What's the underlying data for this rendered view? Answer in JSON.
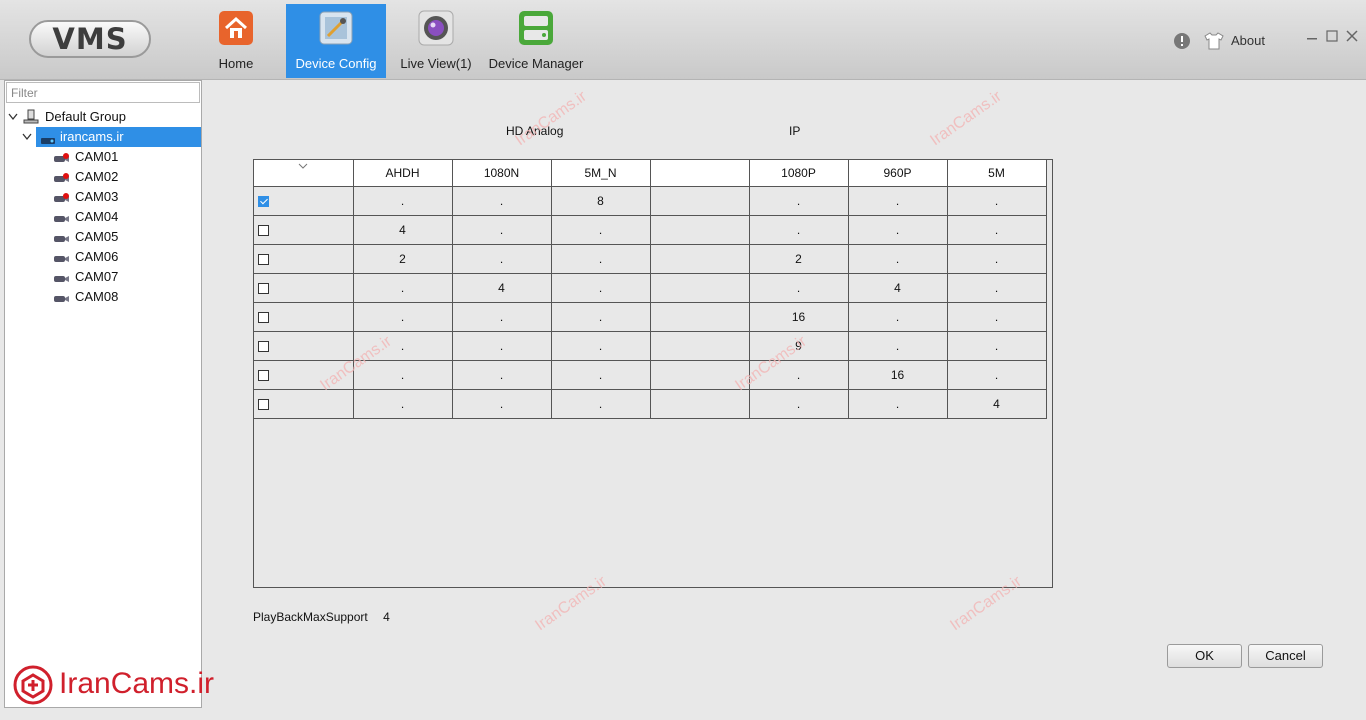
{
  "header": {
    "logo_text": "VMS",
    "tabs": [
      {
        "id": "home",
        "label": "Home",
        "icon": "house-icon"
      },
      {
        "id": "device_config",
        "label": "Device Config",
        "icon": "config-icon",
        "active": true
      },
      {
        "id": "live_view",
        "label": "Live View(1)",
        "icon": "camera-lens-icon"
      },
      {
        "id": "device_manager",
        "label": "Device Manager",
        "icon": "device-manager-icon"
      }
    ],
    "about_label": "About"
  },
  "sidebar": {
    "filter_placeholder": "Filter",
    "root_label": "Default Group",
    "device_label": "irancams.ir",
    "cameras": [
      "CAM01",
      "CAM02",
      "CAM03",
      "CAM04",
      "CAM05",
      "CAM06",
      "CAM07",
      "CAM08"
    ],
    "camera_alarm": [
      true,
      true,
      true,
      false,
      false,
      false,
      false,
      false
    ]
  },
  "main": {
    "group_hd_analog": "HD Analog",
    "group_ip": "IP",
    "columns": [
      "",
      "AHDH",
      "1080N",
      "5M_N",
      "",
      "1080P",
      "960P",
      "5M"
    ],
    "rows": [
      {
        "checked": true,
        "cells": [
          ".",
          ".",
          "8",
          "",
          ".",
          ".",
          "."
        ]
      },
      {
        "checked": false,
        "cells": [
          "4",
          ".",
          ".",
          "",
          ".",
          ".",
          "."
        ]
      },
      {
        "checked": false,
        "cells": [
          "2",
          ".",
          ".",
          "",
          "2",
          ".",
          "."
        ]
      },
      {
        "checked": false,
        "cells": [
          ".",
          "4",
          ".",
          "",
          ".",
          "4",
          "."
        ]
      },
      {
        "checked": false,
        "cells": [
          ".",
          ".",
          ".",
          "",
          "16",
          ".",
          "."
        ]
      },
      {
        "checked": false,
        "cells": [
          ".",
          ".",
          ".",
          "",
          "9",
          ".",
          "."
        ]
      },
      {
        "checked": false,
        "cells": [
          ".",
          ".",
          ".",
          "",
          ".",
          "16",
          "."
        ]
      },
      {
        "checked": false,
        "cells": [
          ".",
          ".",
          ".",
          "",
          ".",
          ".",
          "4"
        ]
      }
    ],
    "playback_label": "PlayBackMaxSupport",
    "playback_value": "4",
    "ok_label": "OK",
    "cancel_label": "Cancel"
  },
  "watermark": {
    "text": "IranCams.ir",
    "brand_text": "IranCams.ir"
  },
  "colors": {
    "accent": "#2f8fe6",
    "brand": "#d0202c"
  }
}
